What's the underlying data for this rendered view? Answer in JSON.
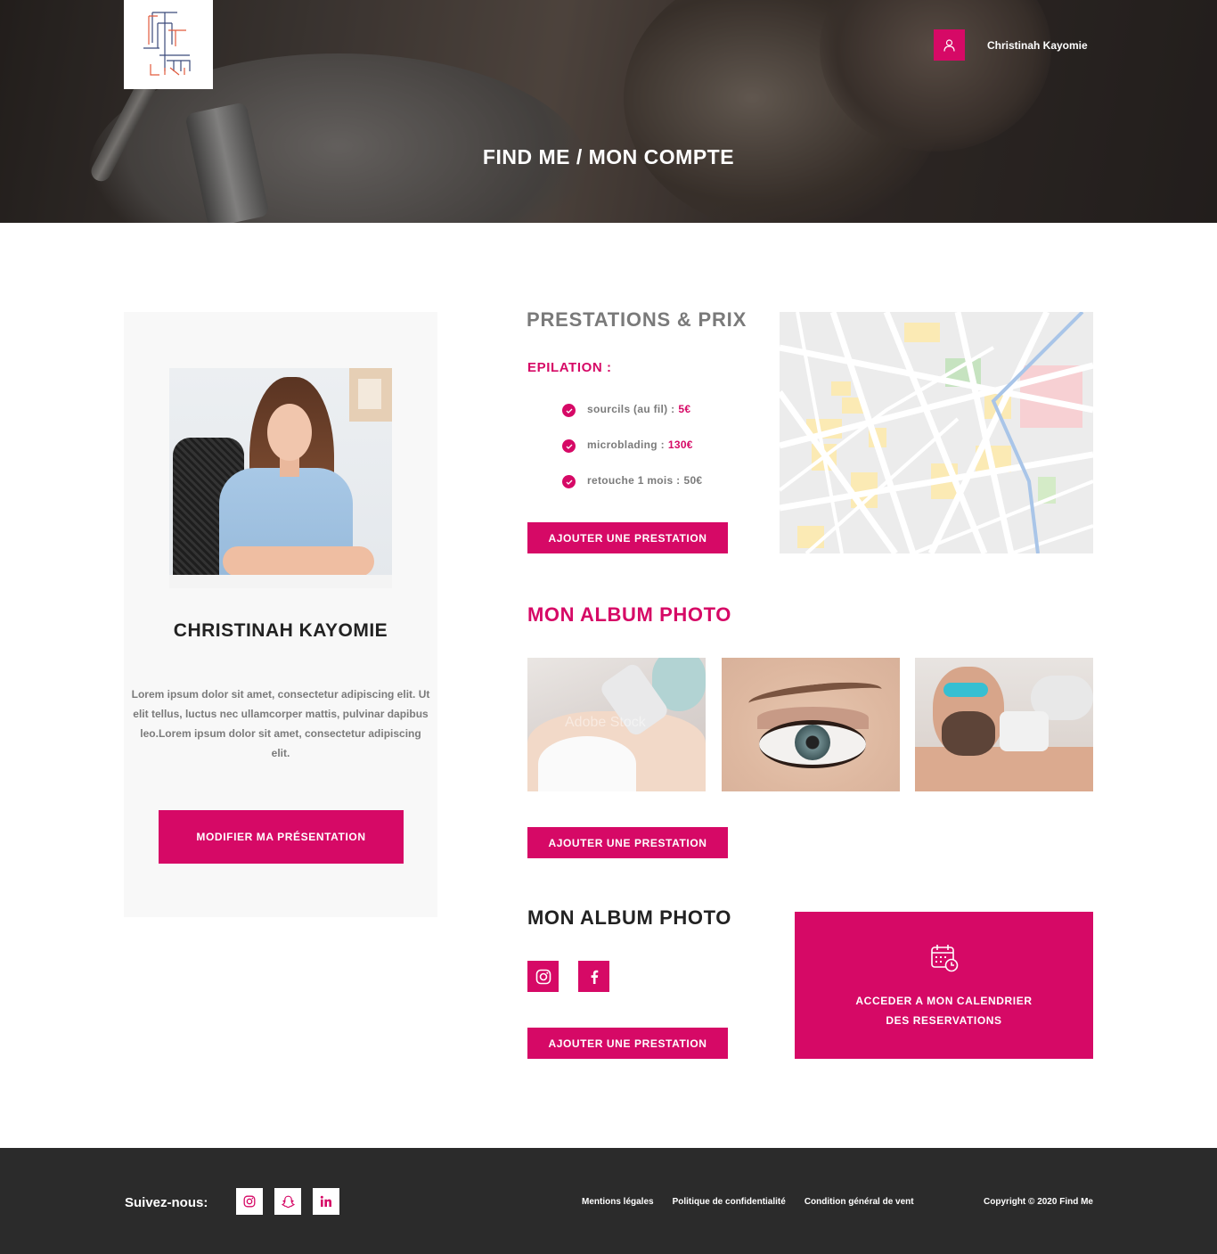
{
  "header": {
    "user_name": "Christinah Kayomie",
    "page_title": "FIND ME / MON COMPTE",
    "logo_text": "FIND ME"
  },
  "profile": {
    "name": "CHRISTINAH KAYOMIE",
    "bio": "Lorem ipsum dolor sit amet, consectetur adipiscing elit. Ut elit tellus, luctus nec ullamcorper mattis, pulvinar dapibus leo.Lorem ipsum dolor sit amet, consectetur adipiscing elit.",
    "modify_label": "MODIFIER MA PRÉSENTATION"
  },
  "prestations": {
    "title": "PRESTATIONS & PRIX",
    "category": "EPILATION :",
    "items": [
      {
        "label": "sourcils (au fil) :",
        "price": "5€"
      },
      {
        "label": "microblading :",
        "price": "130€"
      },
      {
        "label": "retouche 1 mois :",
        "price": "50€"
      }
    ],
    "add_label": "AJOUTER UNE PRESTATION"
  },
  "album": {
    "title": "MON ALBUM PHOTO",
    "add_label": "AJOUTER UNE PRESTATION",
    "photo_watermark": "Adobe Stock"
  },
  "social_album": {
    "title": "MON ALBUM PHOTO",
    "add_label": "AJOUTER UNE PRESTATION",
    "icons": [
      "instagram-icon",
      "facebook-icon"
    ]
  },
  "calendar": {
    "line1": "ACCEDER A MON CALENDRIER",
    "line2": "DES RESERVATIONS"
  },
  "footer": {
    "follow": "Suivez-nous:",
    "links": [
      "Mentions légales",
      "Politique de confidentialité",
      "Condition général de vent"
    ],
    "copyright": "Copyright © 2020 Find Me",
    "icons": [
      "instagram-icon",
      "snapchat-icon",
      "linkedin-icon"
    ]
  },
  "colors": {
    "accent": "#d60966",
    "footer_bg": "#2b2b2b",
    "card_bg": "#f8f8f8"
  }
}
